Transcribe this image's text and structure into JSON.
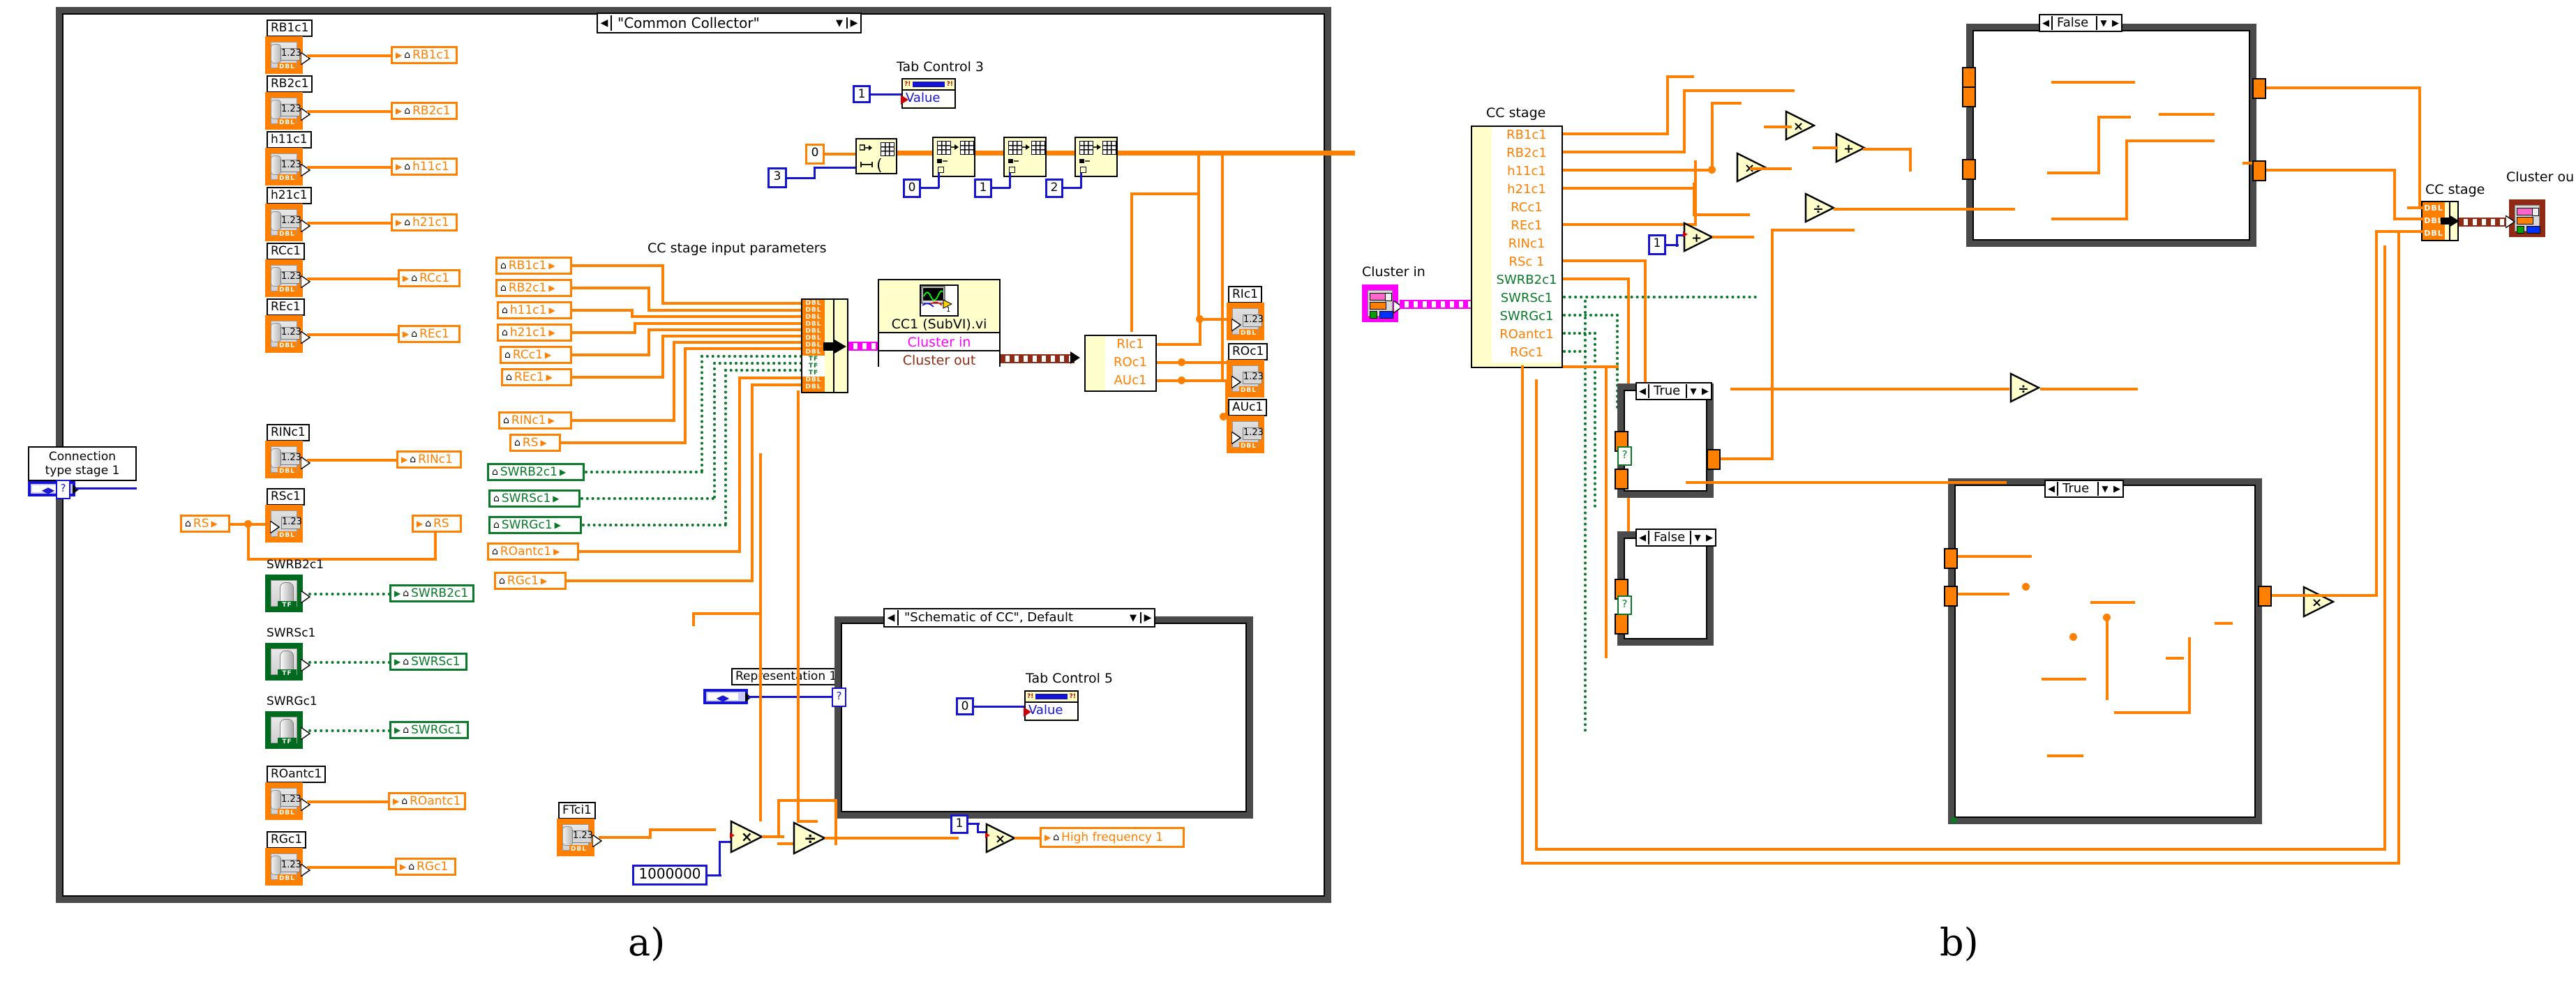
{
  "figure": {
    "panel_a_letter": "a)",
    "panel_b_letter": "b)"
  },
  "panel_a": {
    "enum_ring_top": {
      "label": "\"Common Collector\"",
      "left_arrow": "◀",
      "down_arrow": "▼",
      "right_arrow": "▶"
    },
    "connection_type": {
      "caption_line1": "Connection",
      "caption_line2": "type stage 1"
    },
    "notes": {
      "cc_inputs": "CC stage input parameters",
      "representation": "Representation 1",
      "tab_control_3": "Tab Control 3",
      "tab_control_5": "Tab Control 5",
      "schematic_ring": "\"Schematic of CC\", Default"
    },
    "property_nodes": [
      {
        "name": "Tab Control 3",
        "property": "Value",
        "input_constant": "1"
      },
      {
        "name": "Tab Control 5",
        "property": "Value",
        "input_constant": "0"
      }
    ],
    "controls": [
      {
        "label": "RB1c1",
        "type": "DBL",
        "value": "1.23"
      },
      {
        "label": "RB2c1",
        "type": "DBL",
        "value": "1.23"
      },
      {
        "label": "h11c1",
        "type": "DBL",
        "value": "1.23"
      },
      {
        "label": "h21c1",
        "type": "DBL",
        "value": "1.23"
      },
      {
        "label": "RCc1",
        "type": "DBL",
        "value": "1.23"
      },
      {
        "label": "REc1",
        "type": "DBL",
        "value": "1.23"
      },
      {
        "label": "RINc1",
        "type": "DBL",
        "value": "1.23"
      },
      {
        "label": "RSc1",
        "type": "DBL",
        "value": "1.23"
      },
      {
        "label": "SWRB2c1",
        "type": "TF",
        "value": ""
      },
      {
        "label": "SWRSc1",
        "type": "TF",
        "value": ""
      },
      {
        "label": "SWRGc1",
        "type": "TF",
        "value": ""
      },
      {
        "label": "ROantc1",
        "type": "DBL",
        "value": "1.23"
      },
      {
        "label": "RGc1",
        "type": "DBL",
        "value": "1.23"
      }
    ],
    "locals_col1": [
      {
        "label": "RB1c1",
        "color": "orange"
      },
      {
        "label": "RB2c1",
        "color": "orange"
      },
      {
        "label": "h11c1",
        "color": "orange"
      },
      {
        "label": "h21c1",
        "color": "orange"
      },
      {
        "label": "RCc1",
        "color": "orange"
      },
      {
        "label": "REc1",
        "color": "orange"
      },
      {
        "label": "RINc1",
        "color": "orange"
      },
      {
        "label": "RS",
        "color": "orange"
      },
      {
        "label": "SWRB2c1",
        "color": "green"
      },
      {
        "label": "SWRSc1",
        "color": "green"
      },
      {
        "label": "SWRGc1",
        "color": "green"
      },
      {
        "label": "ROantc1",
        "color": "orange"
      },
      {
        "label": "RGc1",
        "color": "orange"
      }
    ],
    "locals_col2": [
      {
        "label": "RB1c1",
        "color": "orange"
      },
      {
        "label": "RB2c1",
        "color": "orange"
      },
      {
        "label": "h11c1",
        "color": "orange"
      },
      {
        "label": "h21c1",
        "color": "orange"
      },
      {
        "label": "RCc1",
        "color": "orange"
      },
      {
        "label": "REc1",
        "color": "orange"
      },
      {
        "label": "RINc1",
        "color": "orange"
      },
      {
        "label": "RS",
        "color": "orange"
      },
      {
        "label": "SWRB2c1",
        "color": "green"
      },
      {
        "label": "SWRSc1",
        "color": "green"
      },
      {
        "label": "SWRGc1",
        "color": "green"
      },
      {
        "label": "ROantc1",
        "color": "orange"
      },
      {
        "label": "RGc1",
        "color": "orange"
      }
    ],
    "rs_local": {
      "label": "RS"
    },
    "bundle_types": [
      "DBL",
      "DBL",
      "DBL",
      "DBL",
      "DBL",
      "DBL",
      "DBL",
      "DBL",
      "TF",
      "TF",
      "TF",
      "DBL",
      "DBL"
    ],
    "subvi": {
      "title": "CC1 (SubVI).vi",
      "input_pin": "Cluster in",
      "output_pin": "Cluster out",
      "icon_badge": "1"
    },
    "unbundle_fields": [
      "RIc1",
      "ROc1",
      "AUc1"
    ],
    "indicators": [
      {
        "label": "RIc1",
        "type": "DBL",
        "value": "1.23"
      },
      {
        "label": "ROc1",
        "type": "DBL",
        "value": "1.23"
      },
      {
        "label": "AUc1",
        "type": "DBL",
        "value": "1.23"
      }
    ],
    "array_chain": {
      "init_value": "0",
      "size_value": "3",
      "replace_indices": [
        "0",
        "1",
        "2"
      ]
    },
    "frequency": {
      "control_label": "FTci1",
      "control_value": "1.23",
      "multiplier_constant": "1000000",
      "divide_op": "÷",
      "multiply_op": "×",
      "gain_constant": "1",
      "indicator_label": "High frequency 1"
    }
  },
  "panel_b": {
    "cluster_in": {
      "label": "Cluster in"
    },
    "cluster_out": {
      "label": "Cluster ou"
    },
    "unbundle_title": "CC stage",
    "bundle_title": "CC stage",
    "unbundle_fields": [
      {
        "name": "RB1c1",
        "color": "orange"
      },
      {
        "name": "RB2c1",
        "color": "orange"
      },
      {
        "name": "h11c1",
        "color": "orange"
      },
      {
        "name": "h21c1",
        "color": "orange"
      },
      {
        "name": "RCc1",
        "color": "orange"
      },
      {
        "name": "REc1",
        "color": "orange"
      },
      {
        "name": "RINc1",
        "color": "orange"
      },
      {
        "name": "RSc 1",
        "color": "orange"
      },
      {
        "name": "SWRB2c1",
        "color": "green"
      },
      {
        "name": "SWRSc1",
        "color": "green"
      },
      {
        "name": "SWRGc1",
        "color": "green"
      },
      {
        "name": "ROantc1",
        "color": "orange"
      },
      {
        "name": "RGc1",
        "color": "orange"
      }
    ],
    "bundle_types": [
      "DBL",
      "DBL",
      "DBL"
    ],
    "case_structures": [
      {
        "id": "case-top-right",
        "selector": "False"
      },
      {
        "id": "case-mid-left-1",
        "selector": "True"
      },
      {
        "id": "case-mid-left-2",
        "selector": "False"
      },
      {
        "id": "case-bottom-right",
        "selector": "True"
      }
    ],
    "constants": [
      {
        "value": "1"
      }
    ],
    "operators": {
      "multiply": "×",
      "add": "+",
      "divide": "÷"
    }
  },
  "colors": {
    "orange_wire": "#ff7f00",
    "blue_wire": "#1414d2",
    "green_wire": "#0a7a2a",
    "magenta_wire": "#ff00ff",
    "brown_wire": "#8f2b14",
    "node_bg": "#ffffcc"
  }
}
